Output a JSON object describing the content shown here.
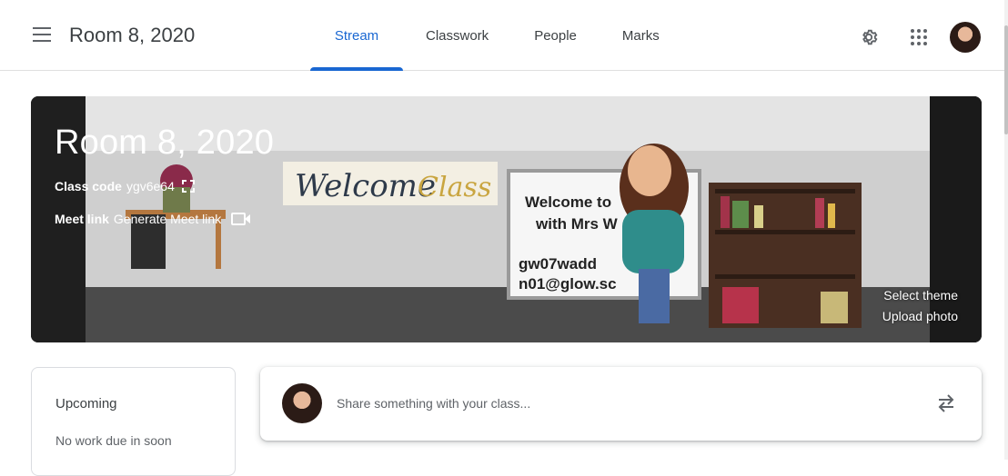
{
  "header": {
    "class_title": "Room 8, 2020",
    "tabs": [
      {
        "label": "Stream"
      },
      {
        "label": "Classwork"
      },
      {
        "label": "People"
      },
      {
        "label": "Marks"
      }
    ],
    "icons": [
      "menu-icon",
      "gear-icon",
      "apps-grid-icon",
      "avatar"
    ]
  },
  "banner": {
    "title": "Room 8, 2020",
    "class_code_label": "Class code",
    "class_code_value": "ygv6e64",
    "meet_label": "Meet link",
    "meet_action": "Generate Meet link",
    "select_theme": "Select theme",
    "upload_photo": "Upload photo",
    "image_sign": "Welcome to Class",
    "board_lines": [
      "Welcome to",
      "with Mrs W",
      "gw07wadd",
      "n01@glow.sc"
    ]
  },
  "upcoming": {
    "title": "Upcoming",
    "empty_text": "No work due in soon"
  },
  "share": {
    "placeholder": "Share something with your class..."
  },
  "colors": {
    "accent": "#1967d2",
    "text": "#3c4043",
    "muted": "#5f6368"
  }
}
